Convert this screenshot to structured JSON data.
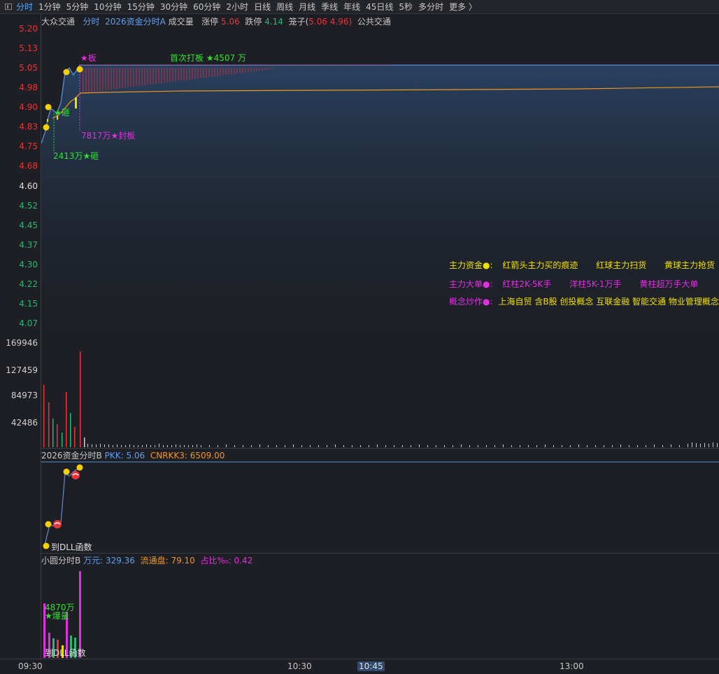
{
  "toolbar": {
    "items": [
      "分时",
      "1分钟",
      "5分钟",
      "10分钟",
      "15分钟",
      "30分钟",
      "60分钟",
      "2小时",
      "日线",
      "周线",
      "月线",
      "季线",
      "年线",
      "45日线",
      "5秒",
      "多分时",
      "更多 〉"
    ]
  },
  "header": {
    "stock": "大众交通",
    "indicator": "分时",
    "name": "2026资金分时A",
    "volume_label": "成交量",
    "limit_up_label": "涨停",
    "limit_up": "5.06",
    "limit_down_label": "跌停",
    "limit_down": "4.14",
    "cage_label": "笼子(",
    "cage_high": "5.06",
    "cage_low": "4.96)",
    "concept": "公共交通"
  },
  "price_axis": {
    "red": [
      "5.20",
      "5.13",
      "5.05",
      "4.98",
      "4.90",
      "4.83",
      "4.75",
      "4.68"
    ],
    "mid": "4.60",
    "green": [
      "4.52",
      "4.45",
      "4.37",
      "4.30",
      "4.22",
      "4.15",
      "4.07"
    ]
  },
  "volume_axis": [
    "169946",
    "127459",
    "84973",
    "42486"
  ],
  "annotations": {
    "ban": "★板",
    "first_board": "首次打板 ★4507 万",
    "seal": "7817万★封板",
    "smash_small": "★砸",
    "smash": "2413万★砸"
  },
  "legend": {
    "row1_title": "主力资金●:",
    "row1": [
      "红箭头主力买的痕迹",
      "红球主力扫货",
      "黄球主力抢货"
    ],
    "row2_title": "主力大单●:",
    "row2": [
      "红柱2K-5K手",
      "洋柱5K-1万手",
      "黄柱超万手大单"
    ],
    "row3_title": "概念炒作●:",
    "row3": "上海自贸 含B股 创投概念 互联金融 智能交通 物业管理概念"
  },
  "panel_b": {
    "name": "2026资金分时B",
    "pkk_label": "PKK:",
    "pkk": "5.06",
    "cnrkk_label": "CNRKK3:",
    "cnrkk": "6509.00",
    "dll": "到DLL函数"
  },
  "panel_c": {
    "name": "小圆分时B",
    "wan_label": "万元:",
    "wan": "329.36",
    "float_label": "流通盘:",
    "float": "79.10",
    "ratio_label": "占比%₀:",
    "ratio": "0.42",
    "burst_amount": "4870万",
    "burst": "★爆量",
    "dll": "到DLL函数"
  },
  "time_axis": {
    "labels": [
      "09:30",
      "10:30",
      "10:45",
      "13:00"
    ]
  },
  "colors": {
    "background": "#1d1f25",
    "price_line": "#5a8fd8",
    "avg_line": "#f0951e",
    "up": "#e8343a",
    "down": "#2bb673",
    "accent_blue": "#4fa6ff"
  }
}
